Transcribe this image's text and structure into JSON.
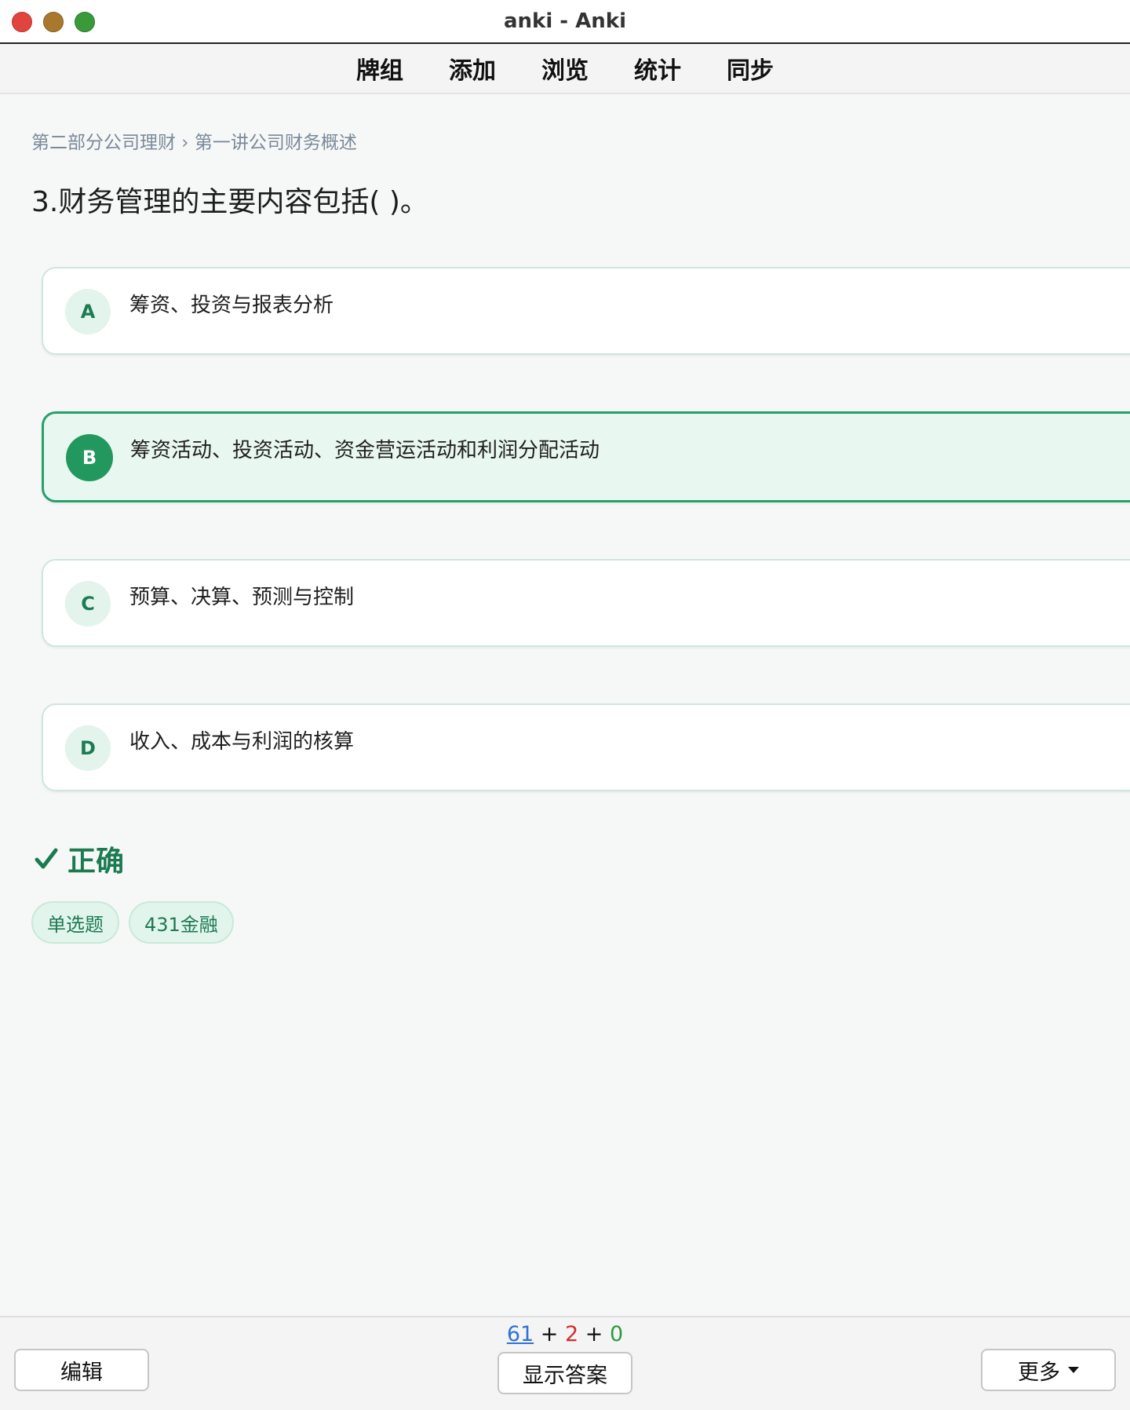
{
  "window": {
    "title": "anki - Anki"
  },
  "toolbar": {
    "items": [
      "牌组",
      "添加",
      "浏览",
      "统计",
      "同步"
    ]
  },
  "card": {
    "breadcrumb": "第二部分公司理财 › 第一讲公司财务概述",
    "question": "3.财务管理的主要内容包括( )。",
    "options": [
      {
        "letter": "A",
        "text": "筹资、投资与报表分析"
      },
      {
        "letter": "B",
        "text": "筹资活动、投资活动、资金营运活动和利润分配活动",
        "selected": true
      },
      {
        "letter": "C",
        "text": "预算、决算、预测与控制"
      },
      {
        "letter": "D",
        "text": "收入、成本与利润的核算"
      }
    ],
    "result": "正确",
    "tags": [
      "单选题",
      "431金融"
    ]
  },
  "bottom": {
    "counts": {
      "new": "61",
      "learn": "2",
      "review": "0"
    },
    "edit_label": "编辑",
    "show_answer_label": "显示答案",
    "more_label": "更多"
  },
  "colors": {
    "accent": "#22985f",
    "count_new": "#2f72d9",
    "count_learn": "#d12e2e",
    "count_review": "#2d9a3f"
  }
}
